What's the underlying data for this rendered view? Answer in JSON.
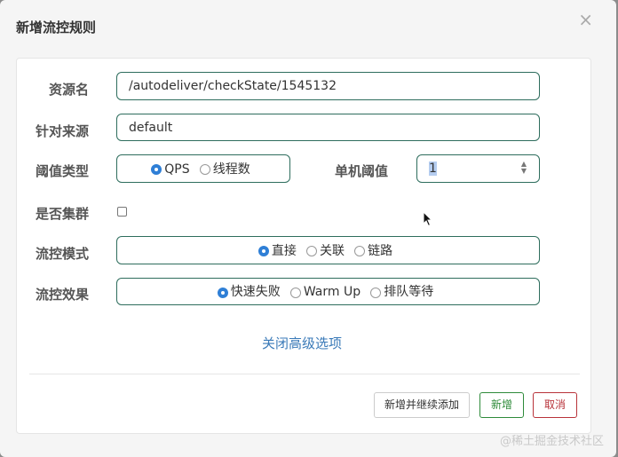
{
  "dialog": {
    "title": "新增流控规则",
    "close_glyph": "×"
  },
  "form": {
    "resource_label": "资源名",
    "resource_value": "/autodeliver/checkState/1545132",
    "source_label": "针对来源",
    "source_value": "default",
    "threshold_type_label": "阈值类型",
    "threshold_type_options": [
      {
        "label": "QPS",
        "selected": true
      },
      {
        "label": "线程数",
        "selected": false
      }
    ],
    "single_threshold_label": "单机阈值",
    "single_threshold_value": "1",
    "cluster_label": "是否集群",
    "cluster_checked": false,
    "flow_mode_label": "流控模式",
    "flow_mode_options": [
      {
        "label": "直接",
        "selected": true
      },
      {
        "label": "关联",
        "selected": false
      },
      {
        "label": "链路",
        "selected": false
      }
    ],
    "flow_effect_label": "流控效果",
    "flow_effect_options": [
      {
        "label": "快速失败",
        "selected": true
      },
      {
        "label": "Warm Up",
        "selected": false
      },
      {
        "label": "排队等待",
        "selected": false
      }
    ],
    "advanced_toggle": "关闭高级选项"
  },
  "footer": {
    "add_continue_label": "新增并继续添加",
    "add_label": "新增",
    "cancel_label": "取消"
  },
  "watermark": "@稀土掘金技术社区",
  "colors": {
    "input_border": "#2e6d5d",
    "radio_selected": "#2f7fd6",
    "link": "#3a7ab8",
    "add_button": "#2e8b3a",
    "cancel_button": "#b8333a"
  },
  "icons": {
    "close": "close-icon",
    "spinner": "number-spinner-icon",
    "cursor": "mouse-pointer-icon"
  }
}
